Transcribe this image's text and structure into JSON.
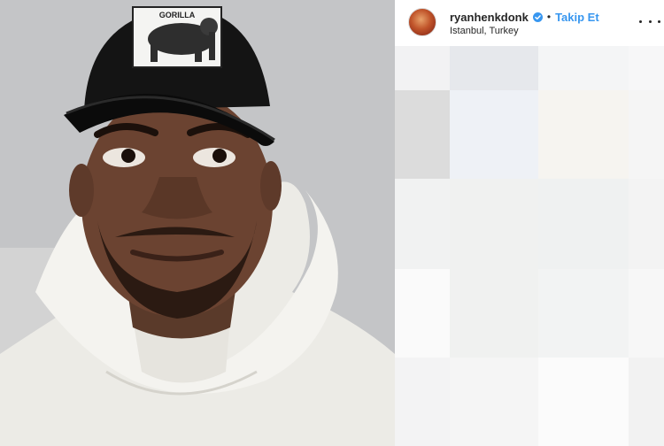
{
  "post": {
    "username": "ryanhenkdonk",
    "separator": "•",
    "follow_label": "Takip Et",
    "location": "Istanbul, Turkey"
  },
  "photo": {
    "cap_patch_text": "GORILLA",
    "subject": "man-in-gorilla-cap-and-white-hoodie"
  },
  "icons": {
    "verified": "verified-badge-icon",
    "more": "more-options-icon"
  },
  "colors": {
    "accent": "#3897f0",
    "text": "#262626",
    "blur_cells": [
      "#f2f2f3",
      "#e6e8ec",
      "#f4f5f6",
      "#f7f7f8",
      "#dcdcdc",
      "#eef1f6",
      "#f6f4f0",
      "#f5f5f5",
      "#f1f2f2",
      "#f0f1f0",
      "#eff1f1",
      "#f3f3f3",
      "#fafafa",
      "#f0f1f0",
      "#f2f3f3",
      "#f7f7f7",
      "#f3f3f4",
      "#f5f5f5",
      "#fbfbfb",
      "#f2f2f2"
    ]
  }
}
